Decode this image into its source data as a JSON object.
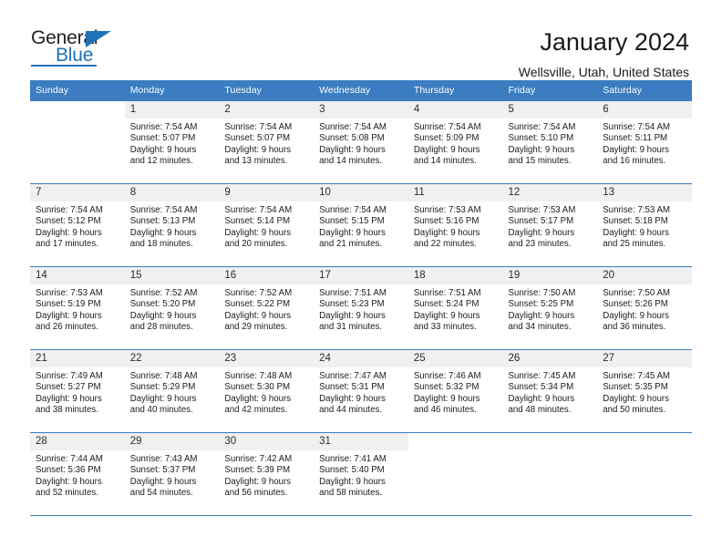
{
  "brand": {
    "name_top": "General",
    "name_bottom": "Blue",
    "accent_color": "#1f72b8"
  },
  "header": {
    "title": "January 2024",
    "subtitle": "Wellsville, Utah, United States"
  },
  "calendar": {
    "header_bg": "#3b7dc0",
    "daynum_bg": "#f0f0f0",
    "weekday_headers": [
      "Sunday",
      "Monday",
      "Tuesday",
      "Wednesday",
      "Thursday",
      "Friday",
      "Saturday"
    ],
    "weeks": [
      [
        {
          "day": "",
          "sunrise": "",
          "sunset": "",
          "daylight_line1": "",
          "daylight_line2": "",
          "blank": true
        },
        {
          "day": "1",
          "sunrise": "Sunrise: 7:54 AM",
          "sunset": "Sunset: 5:07 PM",
          "daylight_line1": "Daylight: 9 hours",
          "daylight_line2": "and 12 minutes."
        },
        {
          "day": "2",
          "sunrise": "Sunrise: 7:54 AM",
          "sunset": "Sunset: 5:07 PM",
          "daylight_line1": "Daylight: 9 hours",
          "daylight_line2": "and 13 minutes."
        },
        {
          "day": "3",
          "sunrise": "Sunrise: 7:54 AM",
          "sunset": "Sunset: 5:08 PM",
          "daylight_line1": "Daylight: 9 hours",
          "daylight_line2": "and 14 minutes."
        },
        {
          "day": "4",
          "sunrise": "Sunrise: 7:54 AM",
          "sunset": "Sunset: 5:09 PM",
          "daylight_line1": "Daylight: 9 hours",
          "daylight_line2": "and 14 minutes."
        },
        {
          "day": "5",
          "sunrise": "Sunrise: 7:54 AM",
          "sunset": "Sunset: 5:10 PM",
          "daylight_line1": "Daylight: 9 hours",
          "daylight_line2": "and 15 minutes."
        },
        {
          "day": "6",
          "sunrise": "Sunrise: 7:54 AM",
          "sunset": "Sunset: 5:11 PM",
          "daylight_line1": "Daylight: 9 hours",
          "daylight_line2": "and 16 minutes."
        }
      ],
      [
        {
          "day": "7",
          "sunrise": "Sunrise: 7:54 AM",
          "sunset": "Sunset: 5:12 PM",
          "daylight_line1": "Daylight: 9 hours",
          "daylight_line2": "and 17 minutes."
        },
        {
          "day": "8",
          "sunrise": "Sunrise: 7:54 AM",
          "sunset": "Sunset: 5:13 PM",
          "daylight_line1": "Daylight: 9 hours",
          "daylight_line2": "and 18 minutes."
        },
        {
          "day": "9",
          "sunrise": "Sunrise: 7:54 AM",
          "sunset": "Sunset: 5:14 PM",
          "daylight_line1": "Daylight: 9 hours",
          "daylight_line2": "and 20 minutes."
        },
        {
          "day": "10",
          "sunrise": "Sunrise: 7:54 AM",
          "sunset": "Sunset: 5:15 PM",
          "daylight_line1": "Daylight: 9 hours",
          "daylight_line2": "and 21 minutes."
        },
        {
          "day": "11",
          "sunrise": "Sunrise: 7:53 AM",
          "sunset": "Sunset: 5:16 PM",
          "daylight_line1": "Daylight: 9 hours",
          "daylight_line2": "and 22 minutes."
        },
        {
          "day": "12",
          "sunrise": "Sunrise: 7:53 AM",
          "sunset": "Sunset: 5:17 PM",
          "daylight_line1": "Daylight: 9 hours",
          "daylight_line2": "and 23 minutes."
        },
        {
          "day": "13",
          "sunrise": "Sunrise: 7:53 AM",
          "sunset": "Sunset: 5:18 PM",
          "daylight_line1": "Daylight: 9 hours",
          "daylight_line2": "and 25 minutes."
        }
      ],
      [
        {
          "day": "14",
          "sunrise": "Sunrise: 7:53 AM",
          "sunset": "Sunset: 5:19 PM",
          "daylight_line1": "Daylight: 9 hours",
          "daylight_line2": "and 26 minutes."
        },
        {
          "day": "15",
          "sunrise": "Sunrise: 7:52 AM",
          "sunset": "Sunset: 5:20 PM",
          "daylight_line1": "Daylight: 9 hours",
          "daylight_line2": "and 28 minutes."
        },
        {
          "day": "16",
          "sunrise": "Sunrise: 7:52 AM",
          "sunset": "Sunset: 5:22 PM",
          "daylight_line1": "Daylight: 9 hours",
          "daylight_line2": "and 29 minutes."
        },
        {
          "day": "17",
          "sunrise": "Sunrise: 7:51 AM",
          "sunset": "Sunset: 5:23 PM",
          "daylight_line1": "Daylight: 9 hours",
          "daylight_line2": "and 31 minutes."
        },
        {
          "day": "18",
          "sunrise": "Sunrise: 7:51 AM",
          "sunset": "Sunset: 5:24 PM",
          "daylight_line1": "Daylight: 9 hours",
          "daylight_line2": "and 33 minutes."
        },
        {
          "day": "19",
          "sunrise": "Sunrise: 7:50 AM",
          "sunset": "Sunset: 5:25 PM",
          "daylight_line1": "Daylight: 9 hours",
          "daylight_line2": "and 34 minutes."
        },
        {
          "day": "20",
          "sunrise": "Sunrise: 7:50 AM",
          "sunset": "Sunset: 5:26 PM",
          "daylight_line1": "Daylight: 9 hours",
          "daylight_line2": "and 36 minutes."
        }
      ],
      [
        {
          "day": "21",
          "sunrise": "Sunrise: 7:49 AM",
          "sunset": "Sunset: 5:27 PM",
          "daylight_line1": "Daylight: 9 hours",
          "daylight_line2": "and 38 minutes."
        },
        {
          "day": "22",
          "sunrise": "Sunrise: 7:48 AM",
          "sunset": "Sunset: 5:29 PM",
          "daylight_line1": "Daylight: 9 hours",
          "daylight_line2": "and 40 minutes."
        },
        {
          "day": "23",
          "sunrise": "Sunrise: 7:48 AM",
          "sunset": "Sunset: 5:30 PM",
          "daylight_line1": "Daylight: 9 hours",
          "daylight_line2": "and 42 minutes."
        },
        {
          "day": "24",
          "sunrise": "Sunrise: 7:47 AM",
          "sunset": "Sunset: 5:31 PM",
          "daylight_line1": "Daylight: 9 hours",
          "daylight_line2": "and 44 minutes."
        },
        {
          "day": "25",
          "sunrise": "Sunrise: 7:46 AM",
          "sunset": "Sunset: 5:32 PM",
          "daylight_line1": "Daylight: 9 hours",
          "daylight_line2": "and 46 minutes."
        },
        {
          "day": "26",
          "sunrise": "Sunrise: 7:45 AM",
          "sunset": "Sunset: 5:34 PM",
          "daylight_line1": "Daylight: 9 hours",
          "daylight_line2": "and 48 minutes."
        },
        {
          "day": "27",
          "sunrise": "Sunrise: 7:45 AM",
          "sunset": "Sunset: 5:35 PM",
          "daylight_line1": "Daylight: 9 hours",
          "daylight_line2": "and 50 minutes."
        }
      ],
      [
        {
          "day": "28",
          "sunrise": "Sunrise: 7:44 AM",
          "sunset": "Sunset: 5:36 PM",
          "daylight_line1": "Daylight: 9 hours",
          "daylight_line2": "and 52 minutes."
        },
        {
          "day": "29",
          "sunrise": "Sunrise: 7:43 AM",
          "sunset": "Sunset: 5:37 PM",
          "daylight_line1": "Daylight: 9 hours",
          "daylight_line2": "and 54 minutes."
        },
        {
          "day": "30",
          "sunrise": "Sunrise: 7:42 AM",
          "sunset": "Sunset: 5:39 PM",
          "daylight_line1": "Daylight: 9 hours",
          "daylight_line2": "and 56 minutes."
        },
        {
          "day": "31",
          "sunrise": "Sunrise: 7:41 AM",
          "sunset": "Sunset: 5:40 PM",
          "daylight_line1": "Daylight: 9 hours",
          "daylight_line2": "and 58 minutes."
        },
        {
          "day": "",
          "sunrise": "",
          "sunset": "",
          "daylight_line1": "",
          "daylight_line2": "",
          "blank": true
        },
        {
          "day": "",
          "sunrise": "",
          "sunset": "",
          "daylight_line1": "",
          "daylight_line2": "",
          "blank": true
        },
        {
          "day": "",
          "sunrise": "",
          "sunset": "",
          "daylight_line1": "",
          "daylight_line2": "",
          "blank": true
        }
      ]
    ]
  }
}
